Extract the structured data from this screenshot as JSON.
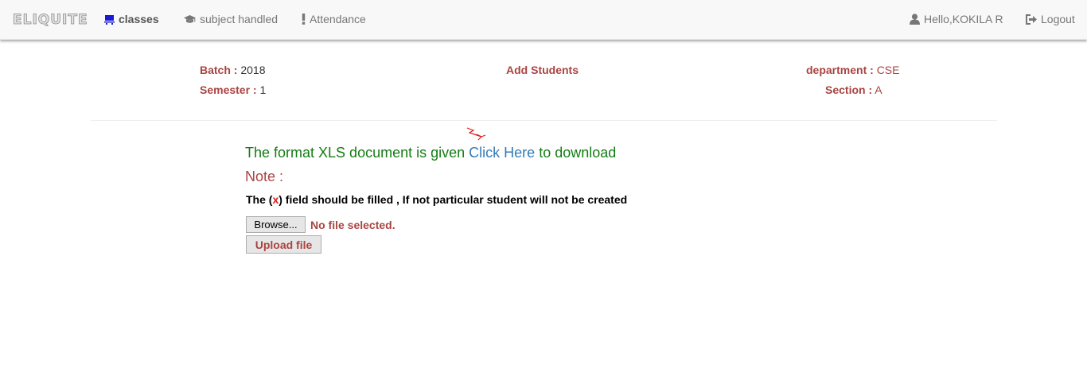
{
  "brand": "ELIQUITE",
  "nav": {
    "classes": "classes",
    "subject_handled": "subject handled",
    "attendance": "Attendance",
    "user": "Hello,KOKILA R",
    "logout": "Logout"
  },
  "info": {
    "batch_label": "Batch :",
    "batch_value": "2018",
    "semester_label": "Semester :",
    "semester_value": "1",
    "page_title": "Add Students",
    "department_label": "department :",
    "department_value": "CSE",
    "section_label": "Section :",
    "section_value": "A"
  },
  "upload": {
    "format_text": "The format XLS document is given",
    "click_here": "Click Here",
    "to_download": "to download",
    "note": "Note :",
    "instruction_pre": "The (",
    "instruction_x": "x",
    "instruction_post": ") field should be filled , If not particular student will not be created",
    "browse_label": "Browse...",
    "no_file": "No file selected.",
    "upload_label": "Upload file"
  },
  "colors": {
    "label_red": "#a94442",
    "success_green": "#137d13",
    "link_blue": "#337ab7",
    "nav_icon_blue": "#1a1ad6"
  }
}
